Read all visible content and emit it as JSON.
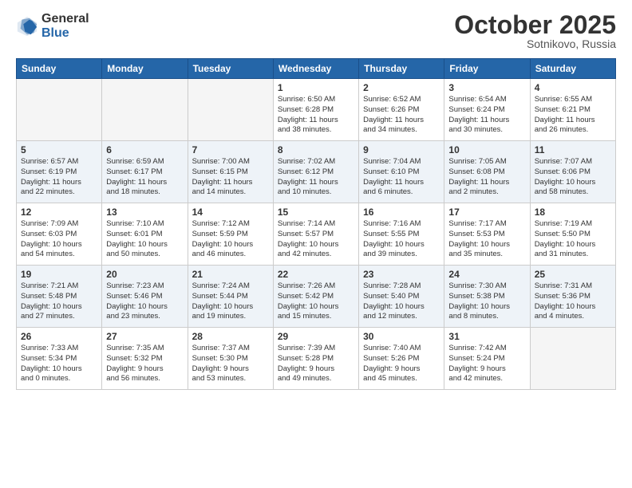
{
  "logo": {
    "general": "General",
    "blue": "Blue"
  },
  "title": "October 2025",
  "location": "Sotnikovo, Russia",
  "days_header": [
    "Sunday",
    "Monday",
    "Tuesday",
    "Wednesday",
    "Thursday",
    "Friday",
    "Saturday"
  ],
  "weeks": [
    {
      "even": false,
      "days": [
        {
          "num": "",
          "info": ""
        },
        {
          "num": "",
          "info": ""
        },
        {
          "num": "",
          "info": ""
        },
        {
          "num": "1",
          "info": "Sunrise: 6:50 AM\nSunset: 6:28 PM\nDaylight: 11 hours\nand 38 minutes."
        },
        {
          "num": "2",
          "info": "Sunrise: 6:52 AM\nSunset: 6:26 PM\nDaylight: 11 hours\nand 34 minutes."
        },
        {
          "num": "3",
          "info": "Sunrise: 6:54 AM\nSunset: 6:24 PM\nDaylight: 11 hours\nand 30 minutes."
        },
        {
          "num": "4",
          "info": "Sunrise: 6:55 AM\nSunset: 6:21 PM\nDaylight: 11 hours\nand 26 minutes."
        }
      ]
    },
    {
      "even": true,
      "days": [
        {
          "num": "5",
          "info": "Sunrise: 6:57 AM\nSunset: 6:19 PM\nDaylight: 11 hours\nand 22 minutes."
        },
        {
          "num": "6",
          "info": "Sunrise: 6:59 AM\nSunset: 6:17 PM\nDaylight: 11 hours\nand 18 minutes."
        },
        {
          "num": "7",
          "info": "Sunrise: 7:00 AM\nSunset: 6:15 PM\nDaylight: 11 hours\nand 14 minutes."
        },
        {
          "num": "8",
          "info": "Sunrise: 7:02 AM\nSunset: 6:12 PM\nDaylight: 11 hours\nand 10 minutes."
        },
        {
          "num": "9",
          "info": "Sunrise: 7:04 AM\nSunset: 6:10 PM\nDaylight: 11 hours\nand 6 minutes."
        },
        {
          "num": "10",
          "info": "Sunrise: 7:05 AM\nSunset: 6:08 PM\nDaylight: 11 hours\nand 2 minutes."
        },
        {
          "num": "11",
          "info": "Sunrise: 7:07 AM\nSunset: 6:06 PM\nDaylight: 10 hours\nand 58 minutes."
        }
      ]
    },
    {
      "even": false,
      "days": [
        {
          "num": "12",
          "info": "Sunrise: 7:09 AM\nSunset: 6:03 PM\nDaylight: 10 hours\nand 54 minutes."
        },
        {
          "num": "13",
          "info": "Sunrise: 7:10 AM\nSunset: 6:01 PM\nDaylight: 10 hours\nand 50 minutes."
        },
        {
          "num": "14",
          "info": "Sunrise: 7:12 AM\nSunset: 5:59 PM\nDaylight: 10 hours\nand 46 minutes."
        },
        {
          "num": "15",
          "info": "Sunrise: 7:14 AM\nSunset: 5:57 PM\nDaylight: 10 hours\nand 42 minutes."
        },
        {
          "num": "16",
          "info": "Sunrise: 7:16 AM\nSunset: 5:55 PM\nDaylight: 10 hours\nand 39 minutes."
        },
        {
          "num": "17",
          "info": "Sunrise: 7:17 AM\nSunset: 5:53 PM\nDaylight: 10 hours\nand 35 minutes."
        },
        {
          "num": "18",
          "info": "Sunrise: 7:19 AM\nSunset: 5:50 PM\nDaylight: 10 hours\nand 31 minutes."
        }
      ]
    },
    {
      "even": true,
      "days": [
        {
          "num": "19",
          "info": "Sunrise: 7:21 AM\nSunset: 5:48 PM\nDaylight: 10 hours\nand 27 minutes."
        },
        {
          "num": "20",
          "info": "Sunrise: 7:23 AM\nSunset: 5:46 PM\nDaylight: 10 hours\nand 23 minutes."
        },
        {
          "num": "21",
          "info": "Sunrise: 7:24 AM\nSunset: 5:44 PM\nDaylight: 10 hours\nand 19 minutes."
        },
        {
          "num": "22",
          "info": "Sunrise: 7:26 AM\nSunset: 5:42 PM\nDaylight: 10 hours\nand 15 minutes."
        },
        {
          "num": "23",
          "info": "Sunrise: 7:28 AM\nSunset: 5:40 PM\nDaylight: 10 hours\nand 12 minutes."
        },
        {
          "num": "24",
          "info": "Sunrise: 7:30 AM\nSunset: 5:38 PM\nDaylight: 10 hours\nand 8 minutes."
        },
        {
          "num": "25",
          "info": "Sunrise: 7:31 AM\nSunset: 5:36 PM\nDaylight: 10 hours\nand 4 minutes."
        }
      ]
    },
    {
      "even": false,
      "days": [
        {
          "num": "26",
          "info": "Sunrise: 7:33 AM\nSunset: 5:34 PM\nDaylight: 10 hours\nand 0 minutes."
        },
        {
          "num": "27",
          "info": "Sunrise: 7:35 AM\nSunset: 5:32 PM\nDaylight: 9 hours\nand 56 minutes."
        },
        {
          "num": "28",
          "info": "Sunrise: 7:37 AM\nSunset: 5:30 PM\nDaylight: 9 hours\nand 53 minutes."
        },
        {
          "num": "29",
          "info": "Sunrise: 7:39 AM\nSunset: 5:28 PM\nDaylight: 9 hours\nand 49 minutes."
        },
        {
          "num": "30",
          "info": "Sunrise: 7:40 AM\nSunset: 5:26 PM\nDaylight: 9 hours\nand 45 minutes."
        },
        {
          "num": "31",
          "info": "Sunrise: 7:42 AM\nSunset: 5:24 PM\nDaylight: 9 hours\nand 42 minutes."
        },
        {
          "num": "",
          "info": ""
        }
      ]
    }
  ]
}
